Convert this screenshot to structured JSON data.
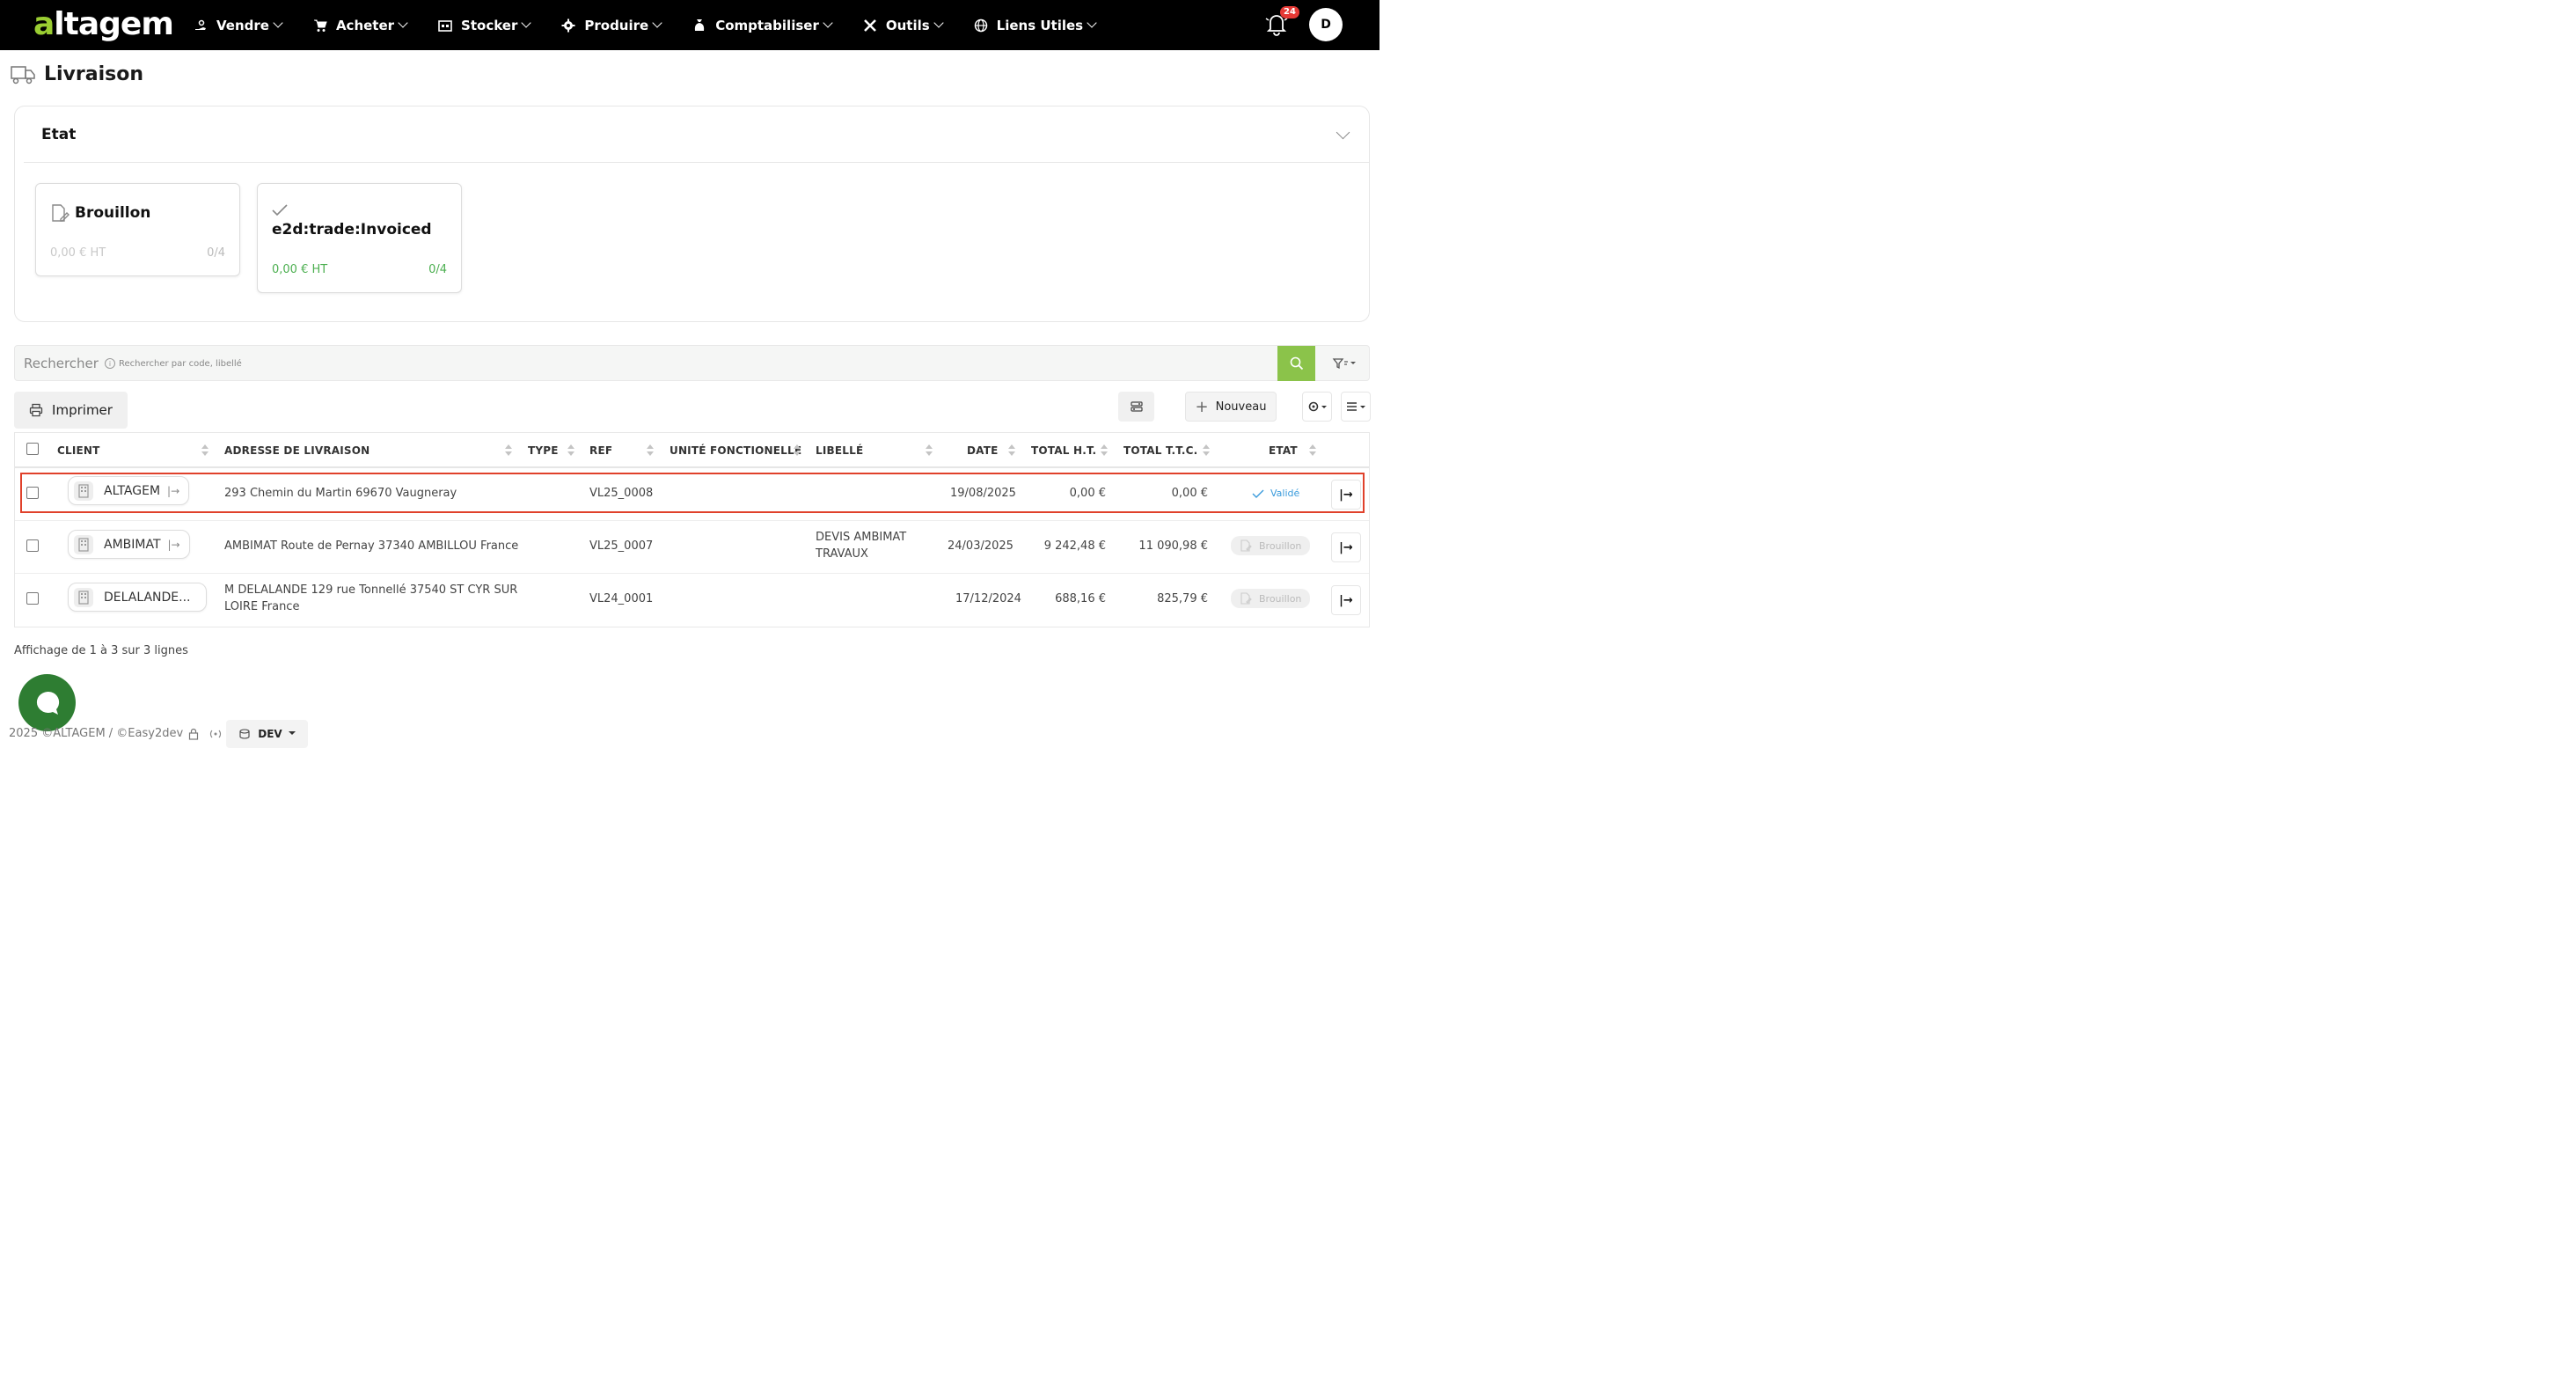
{
  "app": {
    "logo_text_a": "a",
    "logo_text_rest": "ltagem",
    "brand_color": "#9acd32"
  },
  "nav": {
    "items": [
      {
        "label": "Vendre",
        "icon": "hand-coins-icon"
      },
      {
        "label": "Acheter",
        "icon": "cart-icon"
      },
      {
        "label": "Stocker",
        "icon": "warehouse-icon"
      },
      {
        "label": "Produire",
        "icon": "gear-icon"
      },
      {
        "label": "Comptabiliser",
        "icon": "money-bag-icon"
      },
      {
        "label": "Outils",
        "icon": "tools-icon"
      },
      {
        "label": "Liens Utiles",
        "icon": "globe-icon"
      }
    ],
    "notifications_count": "24",
    "avatar_initial": "D"
  },
  "page": {
    "title": "Livraison"
  },
  "etat": {
    "title": "Etat",
    "states": [
      {
        "title": "Brouillon",
        "amount": "0,00 € HT",
        "count": "0/4",
        "color": "#bbbbbb"
      },
      {
        "title": "e2d:trade:Invoiced",
        "amount": "0,00 € HT",
        "count": "0/4",
        "color": "#4caf50"
      }
    ]
  },
  "search": {
    "label": "Rechercher",
    "hint": "Rechercher par code, libellé"
  },
  "toolbar": {
    "print_label": "Imprimer",
    "new_label": "Nouveau"
  },
  "table": {
    "headers": {
      "client": "CLIENT",
      "adresse": "ADRESSE DE LIVRAISON",
      "type": "TYPE",
      "ref": "REF",
      "unite": "UNITÉ FONCTIONELLE",
      "libelle": "LIBELLÉ",
      "date": "DATE",
      "total_ht": "TOTAL H.T.",
      "total_ttc": "TOTAL T.T.C.",
      "etat": "ETAT"
    },
    "rows": [
      {
        "client": "ALTAGEM",
        "adresse_1": "293 Chemin du Martin 69670 Vaugneray",
        "adresse_2": "",
        "ref": "VL25_0008",
        "libelle_1": "",
        "libelle_2": "",
        "date": "19/08/2025",
        "total_ht": "0,00 €",
        "total_ttc": "0,00 €",
        "etat": "Validé"
      },
      {
        "client": "AMBIMAT",
        "adresse_1": "AMBIMAT Route de Pernay 37340 AMBILLOU France",
        "adresse_2": "",
        "ref": "VL25_0007",
        "libelle_1": "DEVIS AMBIMAT",
        "libelle_2": "TRAVAUX",
        "date": "24/03/2025",
        "total_ht": "9 242,48 €",
        "total_ttc": "11 090,98 €",
        "etat": "Brouillon"
      },
      {
        "client": "DELALANDE...",
        "adresse_1": "M DELALANDE 129 rue Tonnellé 37540 ST CYR SUR",
        "adresse_2": "LOIRE France",
        "ref": "VL24_0001",
        "libelle_1": "",
        "libelle_2": "",
        "date": "17/12/2024",
        "total_ht": "688,16 €",
        "total_ttc": "825,79 €",
        "etat": "Brouillon"
      }
    ]
  },
  "footer": {
    "count_text": "Affichage de 1 à 3 sur 3 lignes",
    "copyright": "2025 ©ALTAGEM / ©Easy2dev",
    "env": "DEV"
  }
}
